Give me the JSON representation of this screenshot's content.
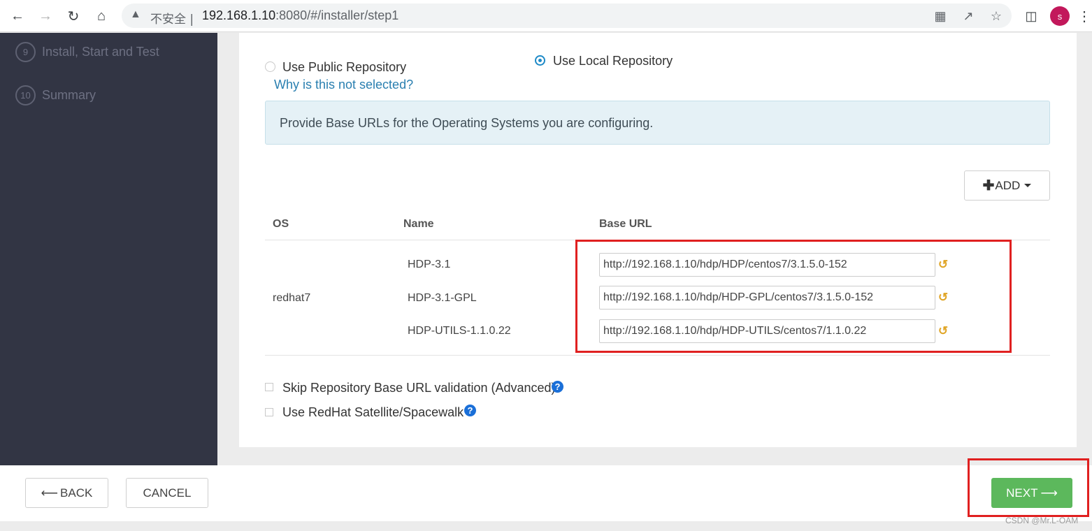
{
  "browser": {
    "security_text": "不安全",
    "url_host": "192.168.1.10",
    "url_rest": ":8080/#/installer/step1",
    "avatar_letter": "s"
  },
  "sidebar": {
    "steps": [
      {
        "number": "9",
        "label": "Install, Start and Test"
      },
      {
        "number": "10",
        "label": "Summary"
      }
    ]
  },
  "repo": {
    "public_label": "Use Public Repository",
    "public_selected": false,
    "why_link": "Why is this not selected?",
    "local_label": "Use Local Repository",
    "local_selected": true,
    "info": "Provide Base URLs for the Operating Systems you are configuring.",
    "add_label": "ADD"
  },
  "table": {
    "headers": {
      "os": "OS",
      "name": "Name",
      "base_url": "Base URL"
    },
    "os": "redhat7",
    "rows": [
      {
        "name": "HDP-3.1",
        "url": "http://192.168.1.10/hdp/HDP/centos7/3.1.5.0-152"
      },
      {
        "name": "HDP-3.1-GPL",
        "url": "http://192.168.1.10/hdp/HDP-GPL/centos7/3.1.5.0-152"
      },
      {
        "name": "HDP-UTILS-1.1.0.22",
        "url": "http://192.168.1.10/hdp/HDP-UTILS/centos7/1.1.0.22"
      }
    ]
  },
  "options": {
    "skip_validation": "Skip Repository Base URL validation (Advanced)",
    "satellite": "Use RedHat Satellite/Spacewalk"
  },
  "footer": {
    "back": "BACK",
    "cancel": "CANCEL",
    "next": "NEXT"
  },
  "watermark": "CSDN @Mr.L-OAM",
  "colors": {
    "sidebar": "#323544",
    "accent": "#1e8ac7",
    "next": "#5cb85c",
    "highlight": "#e02020",
    "undo": "#e0a526"
  }
}
